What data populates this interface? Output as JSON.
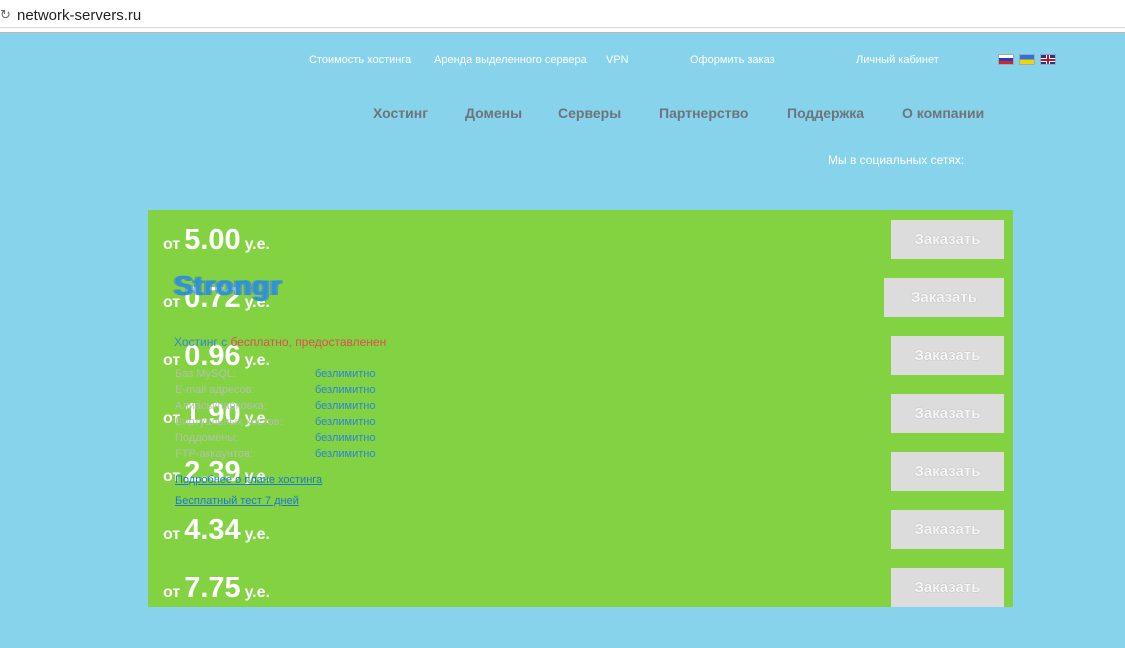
{
  "browser": {
    "url": "network-servers.ru"
  },
  "toplinks": {
    "hosting_cost": "Стоимость хостинга",
    "dedicated": "Аренда выделенного сервера",
    "vpn": "VPN",
    "order": "Оформить заказ",
    "cabinet": "Личный кабинет"
  },
  "nav": [
    "Хостинг",
    "Домены",
    "Серверы",
    "Партнерство",
    "Поддержка",
    "О компании"
  ],
  "social": "Мы в социальных сетях:",
  "plans": [
    {
      "from": "от",
      "price": "5.00",
      "unit": "у.е.",
      "button": "Заказать"
    },
    {
      "from": "от",
      "price": "0.72",
      "unit": "у.е.",
      "button": "Заказать"
    },
    {
      "from": "от",
      "price": "0.96",
      "unit": "у.е.",
      "button": "Заказать"
    },
    {
      "from": "от",
      "price": "1.90",
      "unit": "у.е.",
      "button": "Заказать"
    },
    {
      "from": "от",
      "price": "2.39",
      "unit": "у.е.",
      "button": "Заказать"
    },
    {
      "from": "от",
      "price": "4.34",
      "unit": "у.е.",
      "button": "Заказать"
    },
    {
      "from": "от",
      "price": "7.75",
      "unit": "у.е.",
      "button": "Заказать"
    }
  ],
  "overlay": {
    "title": "Strongr",
    "red_text": "бесплатно, предоставлен",
    "blue_text": "Хостинг с",
    "red_tail": "ен",
    "specs": [
      {
        "label": "Баз MySQL:",
        "value": "безлимитно"
      },
      {
        "label": "E-mail адресов:",
        "value": "безлимитно"
      },
      {
        "label": "Алиасы/парковка:",
        "value": "безлимитно"
      },
      {
        "label": "Виртуальных хостов:",
        "value": "безлимитно"
      },
      {
        "label": "Поддомены:",
        "value": "безлимитно"
      },
      {
        "label": "FTP-аккаунтов:",
        "value": "безлимитно"
      }
    ],
    "more_link": "Подробнее о плане хостинга",
    "trial_link": "Бесплатный тест 7 дней"
  }
}
